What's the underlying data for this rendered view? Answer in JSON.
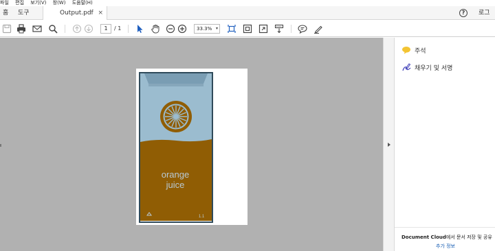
{
  "menu": {
    "items": [
      "파일",
      "편집",
      "보기(V)",
      "창(W)",
      "도움말(H)"
    ]
  },
  "tabs": {
    "home": "홈",
    "tools": "도구",
    "document": "Output.pdf",
    "close_glyph": "×"
  },
  "header": {
    "help_glyph": "?",
    "login": "로그인"
  },
  "toolbar": {
    "page_current": "1",
    "page_total": "/ 1",
    "zoom": "33.3%",
    "zoom_caret": "▾",
    "icons": [
      "save-icon",
      "print-icon",
      "email-icon",
      "search-icon",
      "prev-page-icon",
      "next-page-icon",
      "select-arrow-icon",
      "hand-tool-icon",
      "zoom-out-icon",
      "zoom-in-icon",
      "fit-page-icon",
      "marquee-zoom-icon",
      "full-screen-icon",
      "scroll-mode-icon",
      "comment-icon",
      "sign-icon"
    ]
  },
  "document": {
    "carton_text_line1": "orange",
    "carton_text_line2": "juice",
    "carton_corner_number": "1.1",
    "colors": {
      "carton_top": "#9bbccf",
      "carton_bottom": "#905d04",
      "outline": "#2f4a5a",
      "slice": "#905d04",
      "text": "#b8c9d4"
    }
  },
  "right_panel": {
    "comment_label": "주석",
    "fill_sign_label": "채우기 및 서명",
    "cloud_bold": "Document Cloud",
    "cloud_rest": "에서 문서 저장 및 공유",
    "more_info": "추가 정보",
    "accent": "#1a5fb4",
    "comment_color": "#f3c433",
    "sign_color": "#3d3db8"
  }
}
